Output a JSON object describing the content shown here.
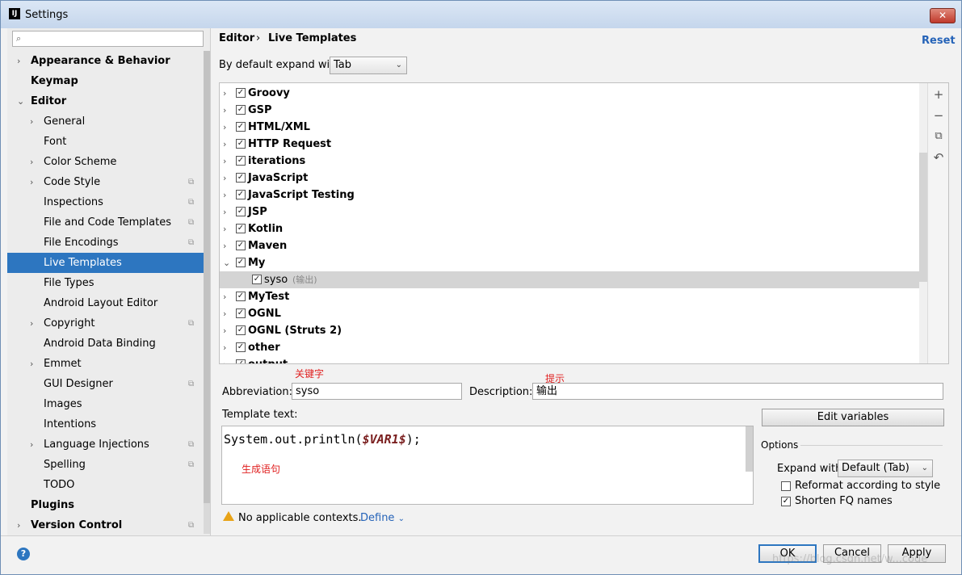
{
  "window": {
    "title": "Settings",
    "app_icon": "IJ",
    "close": "✕"
  },
  "search": {
    "placeholder": ""
  },
  "sidebar": {
    "items": [
      {
        "label": "Appearance & Behavior",
        "level": 0,
        "bold": true,
        "arrow": "›",
        "copy": false
      },
      {
        "label": "Keymap",
        "level": 0,
        "bold": true,
        "arrow": "",
        "copy": false
      },
      {
        "label": "Editor",
        "level": 0,
        "bold": true,
        "arrow": "⌄",
        "copy": false
      },
      {
        "label": "General",
        "level": 1,
        "arrow": "›",
        "copy": false
      },
      {
        "label": "Font",
        "level": 1,
        "arrow": "",
        "copy": false
      },
      {
        "label": "Color Scheme",
        "level": 1,
        "arrow": "›",
        "copy": false
      },
      {
        "label": "Code Style",
        "level": 1,
        "arrow": "›",
        "copy": true
      },
      {
        "label": "Inspections",
        "level": 1,
        "arrow": "",
        "copy": true
      },
      {
        "label": "File and Code Templates",
        "level": 1,
        "arrow": "",
        "copy": true
      },
      {
        "label": "File Encodings",
        "level": 1,
        "arrow": "",
        "copy": true
      },
      {
        "label": "Live Templates",
        "level": 1,
        "arrow": "",
        "copy": false,
        "selected": true
      },
      {
        "label": "File Types",
        "level": 1,
        "arrow": "",
        "copy": false
      },
      {
        "label": "Android Layout Editor",
        "level": 1,
        "arrow": "",
        "copy": false
      },
      {
        "label": "Copyright",
        "level": 1,
        "arrow": "›",
        "copy": true
      },
      {
        "label": "Android Data Binding",
        "level": 1,
        "arrow": "",
        "copy": false
      },
      {
        "label": "Emmet",
        "level": 1,
        "arrow": "›",
        "copy": false
      },
      {
        "label": "GUI Designer",
        "level": 1,
        "arrow": "",
        "copy": true
      },
      {
        "label": "Images",
        "level": 1,
        "arrow": "",
        "copy": false
      },
      {
        "label": "Intentions",
        "level": 1,
        "arrow": "",
        "copy": false
      },
      {
        "label": "Language Injections",
        "level": 1,
        "arrow": "›",
        "copy": true
      },
      {
        "label": "Spelling",
        "level": 1,
        "arrow": "",
        "copy": true
      },
      {
        "label": "TODO",
        "level": 1,
        "arrow": "",
        "copy": false
      },
      {
        "label": "Plugins",
        "level": 0,
        "bold": true,
        "arrow": "",
        "copy": false
      },
      {
        "label": "Version Control",
        "level": 0,
        "bold": true,
        "arrow": "›",
        "copy": true
      }
    ]
  },
  "breadcrumb": {
    "parent": "Editor",
    "sep": "›",
    "current": "Live Templates"
  },
  "reset_label": "Reset",
  "expand": {
    "label": "By default expand with",
    "value": "Tab"
  },
  "template_groups": [
    {
      "label": "Groovy",
      "arrow": "›",
      "checked": true
    },
    {
      "label": "GSP",
      "arrow": "›",
      "checked": true
    },
    {
      "label": "HTML/XML",
      "arrow": "›",
      "checked": true
    },
    {
      "label": "HTTP Request",
      "arrow": "›",
      "checked": true
    },
    {
      "label": "iterations",
      "arrow": "›",
      "checked": true
    },
    {
      "label": "JavaScript",
      "arrow": "›",
      "checked": true
    },
    {
      "label": "JavaScript Testing",
      "arrow": "›",
      "checked": true
    },
    {
      "label": "JSP",
      "arrow": "›",
      "checked": true
    },
    {
      "label": "Kotlin",
      "arrow": "›",
      "checked": true
    },
    {
      "label": "Maven",
      "arrow": "›",
      "checked": true
    },
    {
      "label": "My",
      "arrow": "⌄",
      "checked": true
    },
    {
      "label": "syso",
      "sub": "(输出)",
      "child": true,
      "checked": true
    },
    {
      "label": "MyTest",
      "arrow": "›",
      "checked": true
    },
    {
      "label": "OGNL",
      "arrow": "›",
      "checked": true
    },
    {
      "label": "OGNL (Struts 2)",
      "arrow": "›",
      "checked": true
    },
    {
      "label": "other",
      "arrow": "›",
      "checked": true
    },
    {
      "label": "output",
      "arrow": "›",
      "checked": true
    }
  ],
  "list_tools": {
    "add": "+",
    "remove": "−",
    "copy": "⧉",
    "revert": "↶"
  },
  "annotations": {
    "keyword": "关键字",
    "hint": "提示",
    "generate": "生成语句"
  },
  "abbreviation": {
    "label": "Abbreviation:",
    "value": "syso"
  },
  "description": {
    "label": "Description:",
    "value": "输出"
  },
  "template_text": {
    "label": "Template text:",
    "code_prefix": "System.out.println(",
    "code_var": "$VAR1$",
    "code_suffix": ");"
  },
  "edit_variables_label": "Edit variables",
  "options": {
    "title": "Options",
    "expand_label": "Expand with",
    "expand_value": "Default (Tab)",
    "reformat_label": "Reformat according to style",
    "reformat_checked": false,
    "shorten_label": "Shorten FQ names",
    "shorten_checked": true
  },
  "contexts": {
    "warning": "No applicable contexts.",
    "define": "Define",
    "define_chev": "⌄"
  },
  "buttons": {
    "ok": "OK",
    "cancel": "Cancel",
    "apply": "Apply"
  },
  "help_label": "?",
  "watermark": "https://blog.csdn.net/w...code"
}
